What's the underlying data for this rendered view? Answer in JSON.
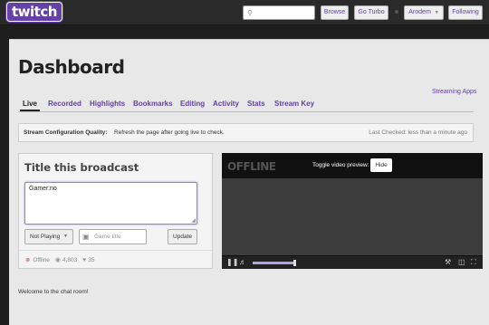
{
  "topbar": {
    "logo": "twitch",
    "search_placeholder": "",
    "browse": "Browse",
    "go_turbo": "Go Turbo",
    "user": "Arodem",
    "following": "Following"
  },
  "page": {
    "title": "Dashboard",
    "streaming_apps": "Streaming Apps"
  },
  "tabs": [
    {
      "label": "Live",
      "active": true
    },
    {
      "label": "Recorded"
    },
    {
      "label": "Highlights"
    },
    {
      "label": "Bookmarks"
    },
    {
      "label": "Editing"
    },
    {
      "label": "Activity"
    },
    {
      "label": "Stats"
    },
    {
      "label": "Stream Key"
    }
  ],
  "config": {
    "label": "Stream Configuration Quality:",
    "message": "Refresh the page after going live to check.",
    "last_checked": "Last Checked: less than a minute ago"
  },
  "broadcast": {
    "title": "Title this broadcast",
    "value": "Gamer.no",
    "now_playing": "Not Playing",
    "game_placeholder": "Game title",
    "update": "Update",
    "status": "Offline",
    "views": "4,803",
    "followers": "35"
  },
  "player": {
    "offline": "OFFLINE",
    "toggle_label": "Toggle video preview:",
    "hide": "Hide",
    "volume_level": 0.95
  },
  "chat": {
    "welcome": "Welcome to the chat room!"
  },
  "colors": {
    "accent": "#6441a5",
    "background": "#1e1e1e",
    "panel": "#e8e8e8"
  }
}
